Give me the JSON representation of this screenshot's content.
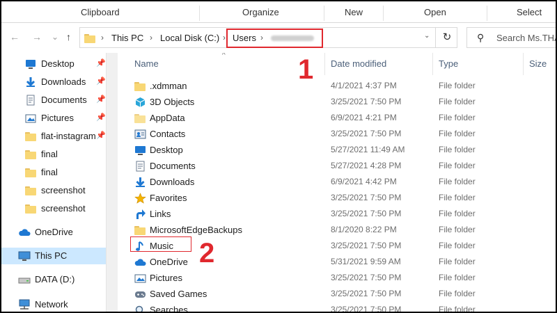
{
  "ribbon": {
    "groups": [
      "Clipboard",
      "Organize",
      "New",
      "Open",
      "Select"
    ]
  },
  "nav": {
    "back": "←",
    "forward": "→",
    "recent": "⌄",
    "up": "↑"
  },
  "address": {
    "crumbs": [
      "This PC",
      "Local Disk (C:)",
      "Users"
    ],
    "separator": "›",
    "refresh": "↻"
  },
  "search": {
    "placeholder": "Search Ms.THA"
  },
  "sidebar": {
    "quick_access": [
      {
        "label": "Desktop",
        "icon": "desktop-icon",
        "pinned": true
      },
      {
        "label": "Downloads",
        "icon": "download-icon",
        "pinned": true
      },
      {
        "label": "Documents",
        "icon": "documents-icon",
        "pinned": true
      },
      {
        "label": "Pictures",
        "icon": "pictures-icon",
        "pinned": true
      },
      {
        "label": "flat-instagram",
        "icon": "folder-icon",
        "pinned": true
      },
      {
        "label": "final",
        "icon": "folder-icon",
        "pinned": false
      },
      {
        "label": "final",
        "icon": "folder-icon",
        "pinned": false
      },
      {
        "label": "screenshot",
        "icon": "folder-icon",
        "pinned": false
      },
      {
        "label": "screenshot",
        "icon": "folder-icon",
        "pinned": false
      }
    ],
    "onedrive": "OneDrive",
    "this_pc": "This PC",
    "data_drive": "DATA (D:)",
    "network": "Network"
  },
  "columns": {
    "name": "Name",
    "date": "Date modified",
    "type": "Type",
    "size": "Size"
  },
  "files": [
    {
      "name": ".xdmman",
      "date": "4/1/2021 4:37 PM",
      "type": "File folder",
      "icon": "folder-icon"
    },
    {
      "name": "3D Objects",
      "date": "3/25/2021 7:50 PM",
      "type": "File folder",
      "icon": "3d-objects-icon"
    },
    {
      "name": "AppData",
      "date": "6/9/2021 4:21 PM",
      "type": "File folder",
      "icon": "folder-icon"
    },
    {
      "name": "Contacts",
      "date": "3/25/2021 7:50 PM",
      "type": "File folder",
      "icon": "contacts-icon"
    },
    {
      "name": "Desktop",
      "date": "5/27/2021 11:49 AM",
      "type": "File folder",
      "icon": "desktop-icon"
    },
    {
      "name": "Documents",
      "date": "5/27/2021 4:28 PM",
      "type": "File folder",
      "icon": "documents-icon"
    },
    {
      "name": "Downloads",
      "date": "6/9/2021 4:42 PM",
      "type": "File folder",
      "icon": "download-icon"
    },
    {
      "name": "Favorites",
      "date": "3/25/2021 7:50 PM",
      "type": "File folder",
      "icon": "star-icon"
    },
    {
      "name": "Links",
      "date": "3/25/2021 7:50 PM",
      "type": "File folder",
      "icon": "link-arrow-icon"
    },
    {
      "name": "MicrosoftEdgeBackups",
      "date": "8/1/2020 8:22 PM",
      "type": "File folder",
      "icon": "folder-icon"
    },
    {
      "name": "Music",
      "date": "3/25/2021 7:50 PM",
      "type": "File folder",
      "icon": "music-note-icon"
    },
    {
      "name": "OneDrive",
      "date": "5/31/2021 9:59 AM",
      "type": "File folder",
      "icon": "cloud-icon"
    },
    {
      "name": "Pictures",
      "date": "3/25/2021 7:50 PM",
      "type": "File folder",
      "icon": "pictures-icon"
    },
    {
      "name": "Saved Games",
      "date": "3/25/2021 7:50 PM",
      "type": "File folder",
      "icon": "saved-games-icon"
    },
    {
      "name": "Searches",
      "date": "3/25/2021 7:50 PM",
      "type": "File folder",
      "icon": "search-icon"
    }
  ],
  "annotations": {
    "step1": "1",
    "step2": "2"
  },
  "colors": {
    "accent": "#e0282e",
    "selection": "#cce8ff",
    "folder": "#f8d775",
    "blue": "#1e78d2"
  }
}
